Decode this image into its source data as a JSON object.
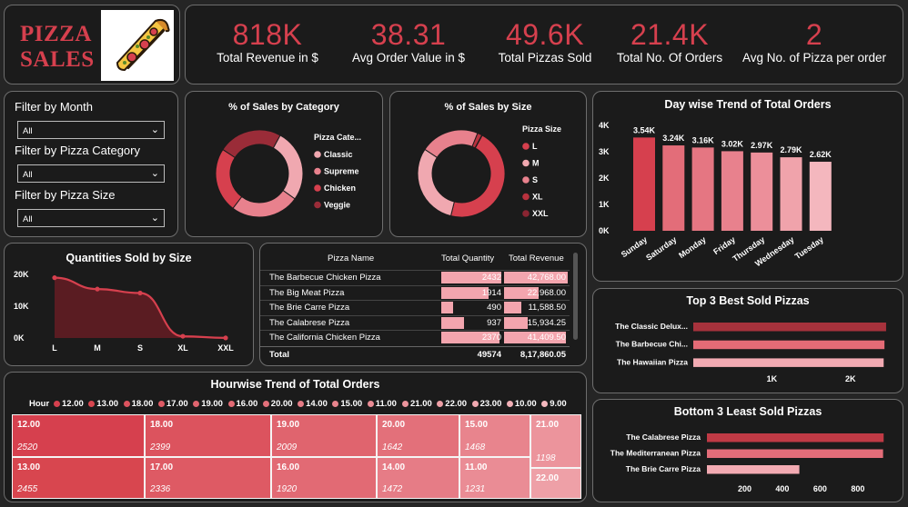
{
  "logo": {
    "line1": "PIZZA",
    "line2": "SALES",
    "image": "pizza-slice"
  },
  "kpis": [
    {
      "value": "818K",
      "label": "Total Revenue in $"
    },
    {
      "value": "38.31",
      "label": "Avg Order Value in $"
    },
    {
      "value": "49.6K",
      "label": "Total Pizzas Sold"
    },
    {
      "value": "21.4K",
      "label": "Total No. Of Orders"
    },
    {
      "value": "2",
      "label": "Avg No. of Pizza per order"
    }
  ],
  "filters": [
    {
      "label": "Filter by Month",
      "value": "All"
    },
    {
      "label": "Filter by Pizza Category",
      "value": "All"
    },
    {
      "label": "Filter by Pizza Size",
      "value": "All"
    }
  ],
  "colors": {
    "accent": "#d6404e",
    "card": "#1b1b1b",
    "background": "#252525"
  },
  "category_chart": {
    "title": "% of Sales by Category",
    "legend_title": "Pizza Cate...",
    "items": [
      {
        "name": "Classic",
        "value": 26.91,
        "color": "#f0a8b0"
      },
      {
        "name": "Supreme",
        "value": 25.46,
        "color": "#e8818d"
      },
      {
        "name": "Chicken",
        "value": 23.96,
        "color": "#d6404e"
      },
      {
        "name": "Veggie",
        "value": 23.68,
        "color": "#9a2c38"
      }
    ]
  },
  "size_chart": {
    "title": "% of Sales by Size",
    "legend_title": "Pizza Size",
    "items": [
      {
        "name": "L",
        "value": 45.89,
        "color": "#d6404e"
      },
      {
        "name": "M",
        "value": 30.49,
        "color": "#f0a8b0"
      },
      {
        "name": "S",
        "value": 21.77,
        "color": "#e8818d"
      },
      {
        "name": "XL",
        "value": 1.72,
        "color": "#b8323e"
      },
      {
        "name": "XXL",
        "value": 0.12,
        "color": "#8a2532"
      }
    ]
  },
  "qty_chart": {
    "title": "Quantities Sold by Size",
    "categories": [
      "L",
      "M",
      "S",
      "XL",
      "XXL"
    ],
    "values": [
      18956,
      15385,
      14137,
      544,
      28
    ],
    "yticks": [
      "20K",
      "10K",
      "0K"
    ],
    "ylim": [
      0,
      20000
    ]
  },
  "table": {
    "headers": [
      "Pizza Name",
      "Total Quantity",
      "Total Revenue"
    ],
    "rows": [
      {
        "name": "The Barbecue Chicken Pizza",
        "qty": "2432",
        "rev": "42,768.00",
        "q": 2432,
        "r": 42768
      },
      {
        "name": "The Big Meat Pizza",
        "qty": "1914",
        "rev": "22,968.00",
        "q": 1914,
        "r": 22968
      },
      {
        "name": "The Brie Carre Pizza",
        "qty": "490",
        "rev": "11,588.50",
        "q": 490,
        "r": 11588.5
      },
      {
        "name": "The Calabrese Pizza",
        "qty": "937",
        "rev": "15,934.25",
        "q": 937,
        "r": 15934.25
      },
      {
        "name": "The California Chicken Pizza",
        "qty": "2370",
        "rev": "41,409.50",
        "q": 2370,
        "r": 41409.5
      }
    ],
    "total": {
      "label": "Total",
      "qty": "49574",
      "rev": "8,17,860.05"
    }
  },
  "day_chart": {
    "title": "Day wise Trend of Total Orders",
    "categories": [
      "Sunday",
      "Saturday",
      "Monday",
      "Friday",
      "Thursday",
      "Wednesday",
      "Tuesday"
    ],
    "values": [
      3540,
      3240,
      3160,
      3020,
      2970,
      2790,
      2620
    ],
    "labels": [
      "3.54K",
      "3.24K",
      "3.16K",
      "3.02K",
      "2.97K",
      "2.79K",
      "2.62K"
    ],
    "yticks": [
      "4K",
      "3K",
      "2K",
      "1K",
      "0K"
    ],
    "ylim": [
      0,
      4000
    ]
  },
  "top3": {
    "title": "Top 3 Best Sold Pizzas",
    "names": [
      "The Classic Delux...",
      "The Barbecue Chi...",
      "The Hawaiian Pizza"
    ],
    "values": [
      2453,
      2432,
      2422
    ],
    "xticks": [
      "1K",
      "2K"
    ]
  },
  "bottom3": {
    "title": "Bottom 3 Least Sold Pizzas",
    "names": [
      "The Calabrese Pizza",
      "The Mediterranean Pizza",
      "The Brie Carre Pizza"
    ],
    "values": [
      937,
      934,
      490
    ],
    "xticks": [
      "200",
      "400",
      "600",
      "800"
    ]
  },
  "hour_chart": {
    "title": "Hourwise Trend of Total Orders",
    "legend_label": "Hour",
    "legend": [
      "12.00",
      "13.00",
      "18.00",
      "17.00",
      "19.00",
      "16.00",
      "20.00",
      "14.00",
      "15.00",
      "11.00",
      "21.00",
      "22.00",
      "23.00",
      "10.00",
      "9.00"
    ],
    "cells": [
      {
        "hour": "12.00",
        "orders": "2520"
      },
      {
        "hour": "13.00",
        "orders": "2455"
      },
      {
        "hour": "18.00",
        "orders": "2399"
      },
      {
        "hour": "17.00",
        "orders": "2336"
      },
      {
        "hour": "19.00",
        "orders": "2009"
      },
      {
        "hour": "16.00",
        "orders": "1920"
      },
      {
        "hour": "20.00",
        "orders": "1642"
      },
      {
        "hour": "14.00",
        "orders": "1472"
      },
      {
        "hour": "15.00",
        "orders": "1468"
      },
      {
        "hour": "11.00",
        "orders": "1231"
      },
      {
        "hour": "21.00",
        "orders": "1198"
      },
      {
        "hour": "22.00",
        "orders": ""
      }
    ]
  }
}
